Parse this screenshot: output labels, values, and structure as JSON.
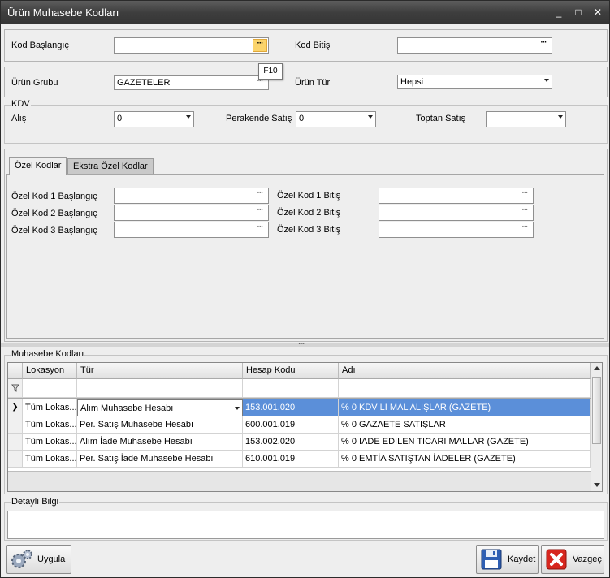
{
  "window": {
    "title": "Ürün Muhasebe Kodları",
    "minimize": "_",
    "maximize": "□",
    "close": "✕"
  },
  "filters": {
    "kod_baslangic_label": "Kod Başlangıç",
    "kod_baslangic_value": "",
    "kod_bitis_label": "Kod Bitiş",
    "kod_bitis_value": "",
    "tooltip": "F10",
    "urun_grubu_label": "Ürün Grubu",
    "urun_grubu_value": "GAZETELER",
    "urun_tur_label": "Ürün  Tür",
    "urun_tur_value": "Hepsi"
  },
  "kdv": {
    "group_label": "KDV",
    "alis_label": "Alış",
    "alis_value": "0",
    "perakende_label": "Perakende Satış",
    "perakende_value": "0",
    "toptan_label": "Toptan Satış",
    "toptan_value": ""
  },
  "tabs": [
    {
      "label": "Özel Kodlar",
      "active": true
    },
    {
      "label": "Ekstra Özel Kodlar",
      "active": false
    }
  ],
  "ozel_kodlar": {
    "k1b": "Özel Kod 1 Başlangıç",
    "k2b": "Özel Kod 2 Başlangıç",
    "k3b": "Özel Kod 3 Başlangıç",
    "k1e": "Özel Kod 1 Bitiş",
    "k2e": "Özel Kod 2 Bitiş",
    "k3e": "Özel Kod 3 Bitiş"
  },
  "splitter": "....",
  "muhasebe": {
    "group_label": "Muhasebe Kodları",
    "columns": [
      "Lokasyon",
      "Tür",
      "Hesap Kodu",
      "Adı"
    ],
    "rows": [
      {
        "lokasyon": "Tüm Lokas...",
        "tur": "Alım Muhasebe Hesabı",
        "hesap": "153.001.020",
        "adi": "% 0 KDV LI MAL ALIŞLAR (GAZETE)",
        "selected": true
      },
      {
        "lokasyon": "Tüm Lokas...",
        "tur": "Per. Satış Muhasebe Hesabı",
        "hesap": "600.001.019",
        "adi": "%  0 GAZAETE SATIŞLAR",
        "selected": false
      },
      {
        "lokasyon": "Tüm Lokas...",
        "tur": "Alım İade Muhasebe Hesabı",
        "hesap": "153.002.020",
        "adi": "% 0 IADE EDILEN TICARI MALLAR (GAZETE)",
        "selected": false
      },
      {
        "lokasyon": "Tüm Lokas...",
        "tur": "Per. Satış İade Muhasebe Hesabı",
        "hesap": "610.001.019",
        "adi": "%  0 EMTİA SATIŞTAN İADELER (GAZETE)",
        "selected": false
      }
    ]
  },
  "detay": {
    "group_label": "Detaylı Bilgi",
    "value": ""
  },
  "buttons": {
    "uygula": "Uygula",
    "kaydet": "Kaydet",
    "vazgec": "Vazgeç"
  },
  "colors": {
    "title_bar": "#3e3e3e",
    "selected_row": "#5b8fd9",
    "ellipsis_hot": "#fbd46b",
    "cancel_red": "#d7261e",
    "save_blue": "#2f5fb3"
  }
}
